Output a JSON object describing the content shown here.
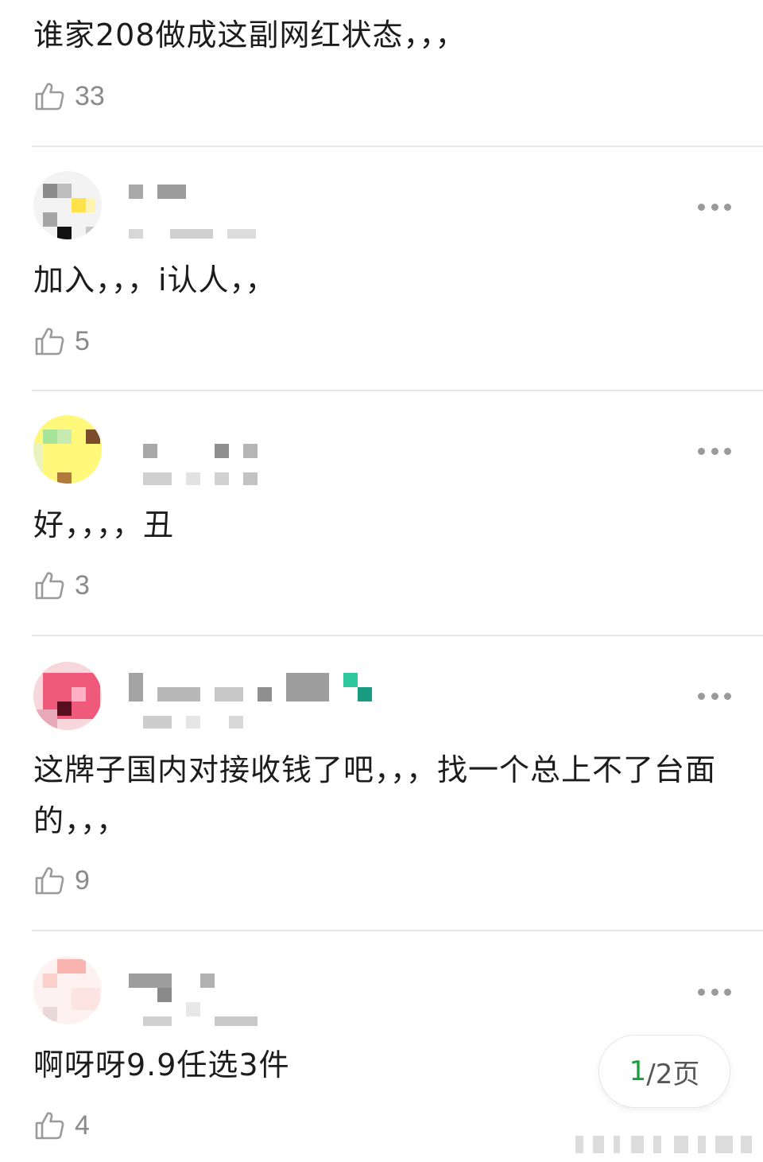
{
  "comments": [
    {
      "text": "谁家208做成这副网红状态，，，",
      "likes": "33"
    },
    {
      "text": "加入，，，i认人，，",
      "likes": "5"
    },
    {
      "text": "好，，，，丑",
      "likes": "3"
    },
    {
      "text": "这牌子国内对接收钱了吧，，，找一个总上不了台面的，，，",
      "likes": "9"
    },
    {
      "text": "啊呀呀9.9任选3件",
      "likes": "4"
    }
  ],
  "pager": {
    "current": "1",
    "rest": "/2页"
  },
  "colors": {
    "accent": "#1a9f3c",
    "like_icon": "#9a9a9a",
    "divider": "#e7e7e7"
  },
  "icons": {
    "like": "thumbs-up-icon",
    "more": "more-dots-icon"
  }
}
